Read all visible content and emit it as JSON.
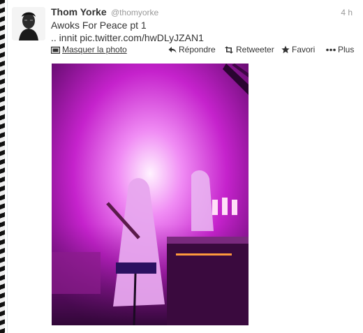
{
  "tweet": {
    "author": {
      "name": "Thom Yorke",
      "handle": "@thomyorke"
    },
    "time": "4 h",
    "text_line1": "Awoks For Peace pt 1",
    "text_prefix": ".. innit ",
    "link": "pic.twitter.com/hwDLyJZAN1",
    "actions": {
      "hide_photo": "Masquer la photo",
      "reply": "Répondre",
      "retweet": "Retweeter",
      "favorite": "Favori",
      "more": "Plus"
    }
  },
  "icons": [
    "media-icon",
    "reply-icon",
    "retweet-icon",
    "star-icon",
    "more-icon"
  ],
  "colors": {
    "photo_magenta": "#c322c8",
    "text": "#333333",
    "muted": "#999999"
  }
}
